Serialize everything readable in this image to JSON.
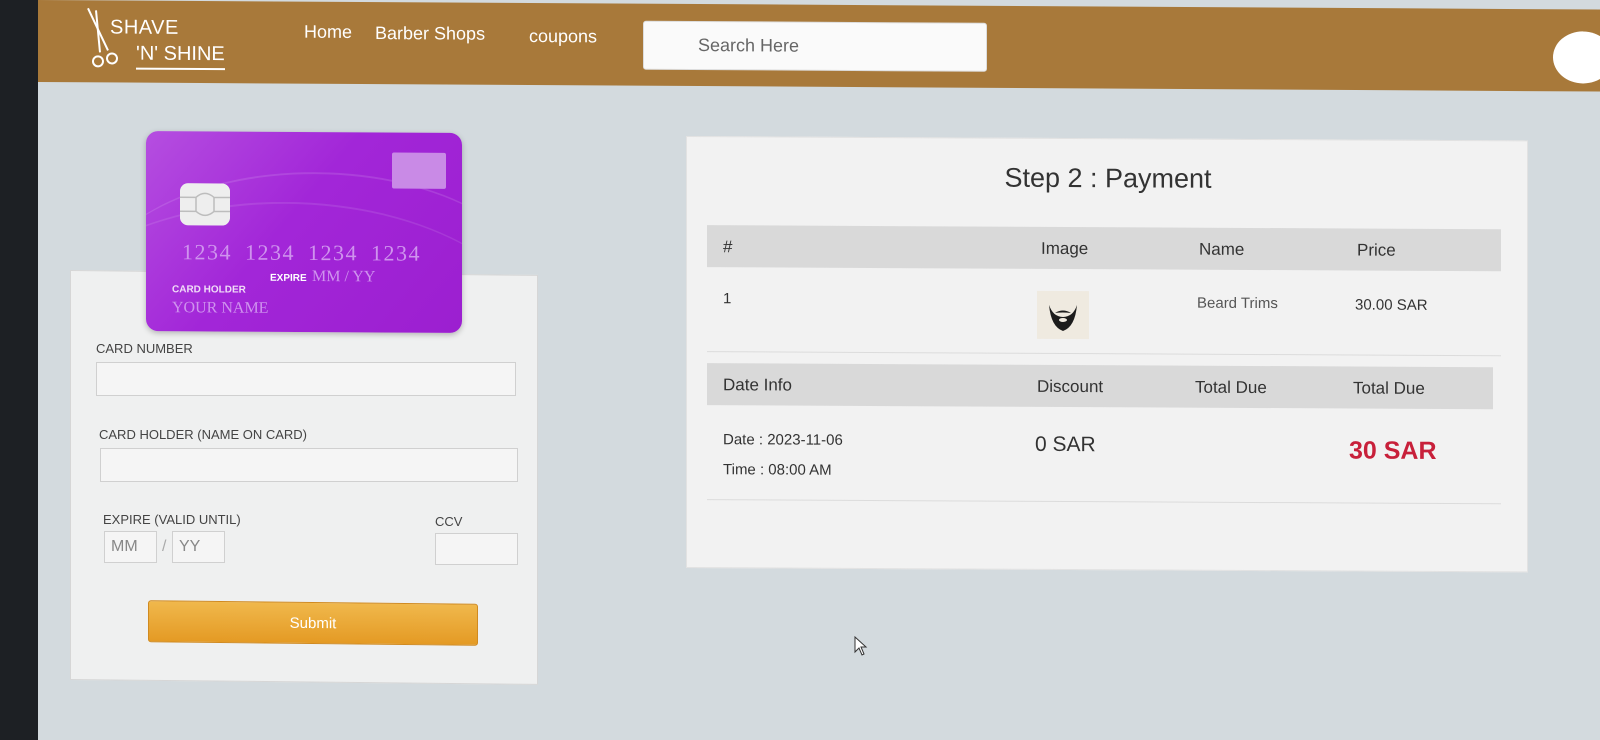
{
  "brand": {
    "line1": "SHAVE",
    "line2": "'N' SHINE"
  },
  "nav": {
    "links": [
      "Home",
      "Barber Shops",
      "coupons"
    ]
  },
  "search": {
    "placeholder": "Search Here"
  },
  "card_preview": {
    "number": "1234 1234 1234 1234",
    "expire_label": "EXPIRE",
    "expire_value": "MM / YY",
    "holder_label": "CARD HOLDER",
    "holder_value": "YOUR NAME"
  },
  "form": {
    "card_number_label": "CARD NUMBER",
    "card_holder_label": "CARD HOLDER (NAME ON CARD)",
    "expire_label": "EXPIRE (VALID UNTIL)",
    "mm_placeholder": "MM",
    "slash": "/",
    "yy_placeholder": "YY",
    "ccv_label": "CCV",
    "submit_label": "Submit"
  },
  "payment": {
    "title": "Step 2 : Payment",
    "item_headers": [
      "#",
      "Image",
      "Name",
      "Price"
    ],
    "items": [
      {
        "index": "1",
        "image": "beard-icon",
        "name": "Beard Trims",
        "price": "30.00 SAR"
      }
    ],
    "summary_headers": [
      "Date Info",
      "Discount",
      "Total Due",
      "Total Due"
    ],
    "date_label": "Date :",
    "date_value": "2023-11-06",
    "time_label": "Time :",
    "time_value": "08:00 AM",
    "discount": "0 SAR",
    "total_due": "30 SAR"
  },
  "colors": {
    "header": "#a8793a",
    "card": "#a226d8",
    "submit": "#e9a630",
    "total": "#c8203a"
  }
}
